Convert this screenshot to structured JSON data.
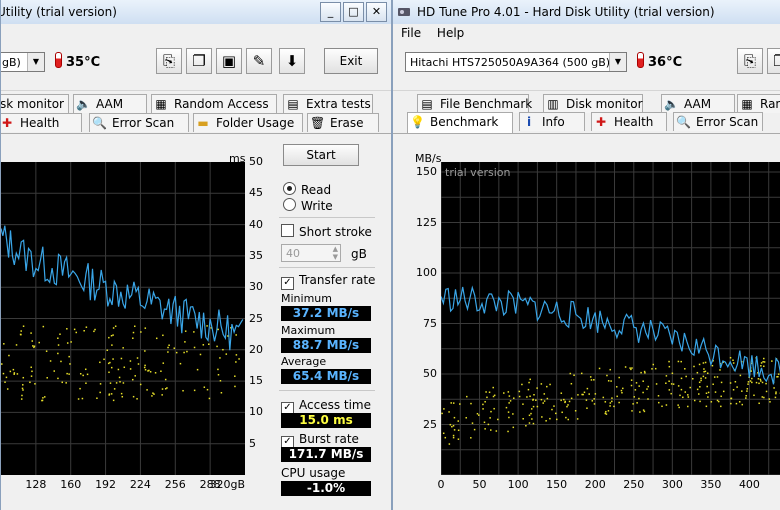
{
  "left_window": {
    "title": "Utility (trial version)",
    "title_buttons": [
      "_",
      "□",
      "✕"
    ],
    "drive_select_value": "gB)",
    "temperature": "35°C",
    "exit_label": "Exit",
    "tabs_row1": [
      "sk monitor",
      "AAM",
      "Random Access",
      "Extra tests"
    ],
    "tabs_row2": [
      "Health",
      "Error Scan",
      "Folder Usage",
      "Erase"
    ],
    "graph": {
      "ms_unit": "ms",
      "ms_ticks": [
        "50",
        "45",
        "40",
        "35",
        "30",
        "25",
        "20",
        "15",
        "10",
        "5"
      ],
      "x_ticks": [
        "128",
        "160",
        "192",
        "224",
        "256",
        "288",
        "320gB"
      ]
    },
    "panel": {
      "start_label": "Start",
      "read_label": "Read",
      "write_label": "Write",
      "short_stroke_label": "Short stroke",
      "short_stroke_value": "40",
      "gb_unit": "gB",
      "transfer_rate_label": "Transfer rate",
      "minimum_label": "Minimum",
      "minimum_value": "37.2 MB/s",
      "maximum_label": "Maximum",
      "maximum_value": "88.7 MB/s",
      "average_label": "Average",
      "average_value": "65.4 MB/s",
      "access_time_label": "Access time",
      "access_time_value": "15.0 ms",
      "burst_rate_label": "Burst rate",
      "burst_rate_value": "171.7 MB/s",
      "cpu_usage_label": "CPU usage",
      "cpu_usage_value": "-1.0%"
    }
  },
  "right_window": {
    "title": "HD Tune Pro 4.01 - Hard Disk Utility (trial version)",
    "menu": [
      "File",
      "Help"
    ],
    "drive_select_value": "Hitachi HTS725050A9A364 (500 gB)",
    "temperature": "36°C",
    "tabs_row1": [
      "File Benchmark",
      "Disk monitor",
      "AAM",
      "Ran"
    ],
    "tabs_row2": [
      "Benchmark",
      "Info",
      "Health",
      "Error Scan"
    ],
    "graph": {
      "unit": "MB/s",
      "watermark": "trial version",
      "y_ticks": [
        "150",
        "125",
        "100",
        "75",
        "50",
        "25"
      ],
      "x_ticks": [
        "0",
        "50",
        "100",
        "150",
        "200",
        "250",
        "300",
        "350",
        "400",
        "45"
      ]
    }
  },
  "colors": {
    "graph_bg": "#000000",
    "grid": "#3a3a3a",
    "transfer_line": "#3aa6e8",
    "access_points": "#e8e02a",
    "accent_value_text": "#ffff40"
  },
  "chart_data": [
    {
      "type": "line",
      "xlabel": "",
      "ylabel": "",
      "x_unit": "gB",
      "x_range": [
        96,
        320
      ],
      "y_right_unit": "ms",
      "y_right_range": [
        0,
        50
      ],
      "series": [
        {
          "x": [
            96,
            110,
            128,
            145,
            160,
            176,
            192,
            208,
            224,
            240,
            256,
            272,
            288,
            304,
            320
          ],
          "y": [
            38,
            36,
            34,
            33,
            32,
            31,
            30,
            29,
            28,
            27,
            26,
            25,
            24,
            23,
            22
          ]
        }
      ],
      "scatter_range_ms": [
        12,
        24
      ]
    },
    {
      "type": "line",
      "xlabel": "",
      "ylabel": "",
      "y_unit": "MB/s",
      "y_range": [
        0,
        150
      ],
      "x_range": [
        0,
        450
      ],
      "series": [
        {
          "x": [
            0,
            25,
            50,
            75,
            100,
            125,
            150,
            175,
            200,
            225,
            250,
            275,
            300,
            325,
            350,
            375,
            400,
            425,
            450
          ],
          "y": [
            88,
            87,
            86,
            85,
            84,
            83,
            81,
            79,
            77,
            75,
            73,
            70,
            67,
            64,
            61,
            58,
            55,
            52,
            50
          ]
        },
        {
          "x": [
            0,
            50,
            100,
            150,
            200,
            250,
            300,
            350,
            400,
            450
          ],
          "y": [
            26,
            31,
            35,
            38,
            41,
            43,
            45,
            46,
            47,
            48
          ]
        }
      ]
    }
  ]
}
